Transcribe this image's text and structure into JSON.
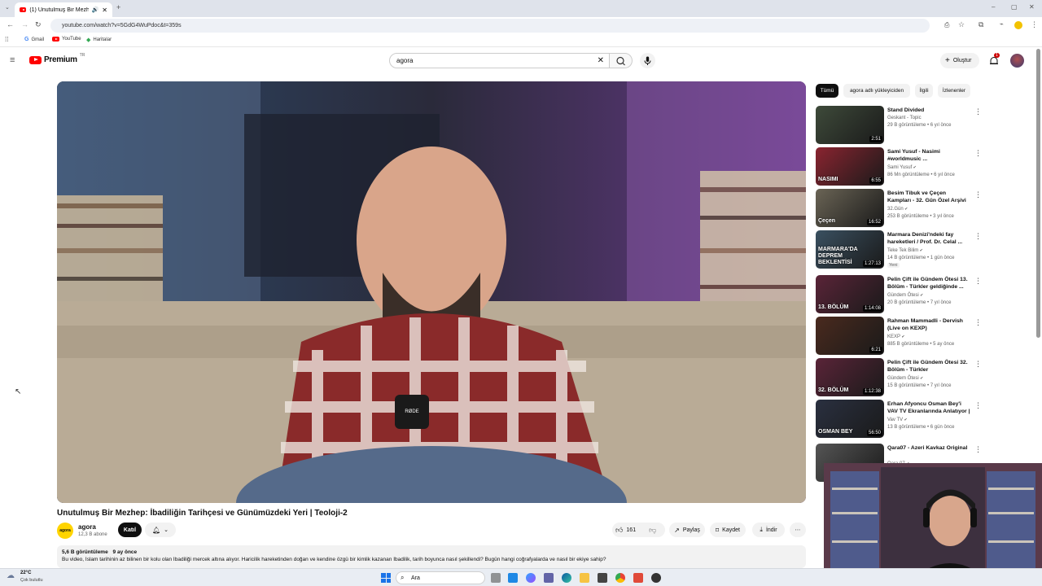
{
  "browser": {
    "tab_title": "(1) Unutulmuş Bir Mezhep",
    "url": "youtube.com/watch?v=5GdG4WuPdoc&t=359s",
    "bookmarks": [
      "Gmail",
      "YouTube",
      "Haritalar"
    ]
  },
  "masthead": {
    "logo_text": "Premium",
    "logo_region": "TR",
    "search_value": "agora",
    "create_label": "Oluştur",
    "notification_count": "1"
  },
  "video": {
    "title": "Unutulmuş Bir Mezhep: İbadiliğin Tarihçesi ve Günümüzdeki Yeri | Teoloji-2",
    "channel_name": "agora",
    "subscribers": "12,3 B abone",
    "join_label": "Katıl",
    "likes": "161",
    "share_label": "Paylaş",
    "save_label": "Kaydet",
    "download_label": "İndir",
    "views": "5,6 B görüntüleme",
    "date": "9 ay önce",
    "description": "Bu video, İslam tarihinin az bilinen bir kolu olan İbadiliği mercek altına alıyor. Haricilik hareketinden doğan ve kendine özgü bir kimlik kazanan İbadilik, tarih boyunca nasıl şekillendi? Bugün hangi coğrafyalarda ve nasıl bir ekiye sahip?",
    "mic_logo_text": "RØDE"
  },
  "chips": [
    "Tümü",
    "agora adlı yükleyiciden",
    "İlgili",
    "İzlenenler"
  ],
  "recommendations": [
    {
      "title": "Stand Divided",
      "channel": "Geskant - Topic",
      "meta": "29 B görüntüleme • 6 yıl önce",
      "duration": "2:51",
      "verified": false,
      "is_new": false,
      "color": "#3e4a3a"
    },
    {
      "title": "Sami Yusuf - Nasimi #worldmusic ...",
      "channel": "Sami Yusuf",
      "meta": "86 Mn görüntüleme • 6 yıl önce",
      "duration": "6:55",
      "verified": true,
      "is_new": false,
      "color": "#8a2430",
      "thumb_text": "NASIMI"
    },
    {
      "title": "Besim Tibuk ve Çeçen Kampları - 32. Gün Özel Arşivi",
      "channel": "32.Gün",
      "meta": "253 B görüntüleme • 3 yıl önce",
      "duration": "16:52",
      "verified": true,
      "is_new": false,
      "color": "#6a6455",
      "thumb_text": "Çeçen"
    },
    {
      "title": "Marmara Denizi'ndeki fay hareketleri / Prof. Dr. Celal ...",
      "channel": "Teke Tek Bilim",
      "meta": "14 B görüntüleme • 1 gün önce",
      "duration": "1:27:13",
      "verified": true,
      "is_new": true,
      "new_label": "Yeni",
      "color": "#3a5060",
      "thumb_text": "MARMARA'DA DEPREM BEKLENTİSİ"
    },
    {
      "title": "Pelin Çift ile Gündem Ötesi 13. Bölüm - Türkler geldiğinde ...",
      "channel": "Gündem Ötesi",
      "meta": "20 B görüntüleme • 7 yıl önce",
      "duration": "1:14:08",
      "verified": true,
      "is_new": false,
      "color": "#5a2438",
      "thumb_text": "13. BÖLÜM"
    },
    {
      "title": "Rahman Mammadli - Dervish (Live on KEXP)",
      "channel": "KEXP",
      "meta": "885 B görüntüleme • 5 ay önce",
      "duration": "6:21",
      "verified": true,
      "is_new": false,
      "color": "#4a2a1e"
    },
    {
      "title": "Pelin Çift ile Gündem Ötesi 32. Bölüm - Türkler",
      "channel": "Gündem Ötesi",
      "meta": "15 B görüntüleme • 7 yıl önce",
      "duration": "1:12:38",
      "verified": true,
      "is_new": false,
      "color": "#5a2438",
      "thumb_text": "32. BÖLÜM"
    },
    {
      "title": "Erhan Afyoncu Osman Bey'i VAV TV Ekranlarında Anlatıyor | ...",
      "channel": "Vav TV",
      "meta": "13 B görüntüleme • 6 gün önce",
      "duration": "56:50",
      "verified": true,
      "is_new": false,
      "color": "#2a3040",
      "thumb_text": "OSMAN BEY"
    },
    {
      "title": "Qara07 - Azeri Kavkaz Original",
      "channel": "Qara 07",
      "meta": "",
      "duration": "",
      "verified": true,
      "is_new": false,
      "color": "#555555"
    }
  ],
  "taskbar": {
    "weather_temp": "22°C",
    "weather_desc": "Çok bulutlu",
    "search_placeholder": "Ara"
  },
  "colors": {
    "accent_red": "#ff0000",
    "dark_button": "#0f0f0f",
    "chip_bg": "#f2f2f2"
  }
}
